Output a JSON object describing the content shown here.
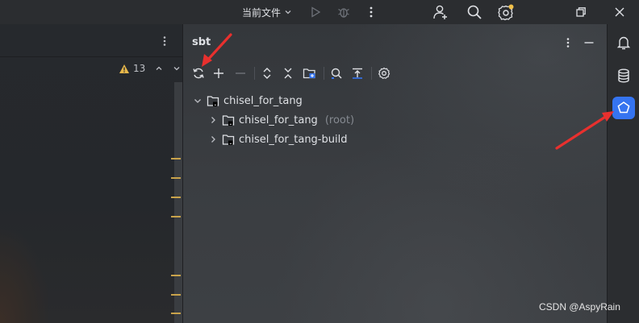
{
  "titlebar": {
    "run_config": "当前文件",
    "icons": [
      "chevron-down-icon",
      "run-icon",
      "debug-icon",
      "more-vertical-icon",
      "add-user-icon",
      "search-icon",
      "settings-icon",
      "restore-window-icon",
      "close-icon"
    ],
    "accent": "#f0c04a"
  },
  "editor": {
    "inspection_count": "13",
    "warning_color": "#e8b84a"
  },
  "sbt_panel": {
    "title": "sbt",
    "toolbar": [
      "reload-icon",
      "add-icon",
      "remove-icon",
      "expand-all-icon",
      "collapse-all-icon",
      "open-config-icon",
      "analyze-icon",
      "toggle-offline-icon",
      "settings-icon"
    ],
    "tree": {
      "root": {
        "label": "chisel_for_tang"
      },
      "children": [
        {
          "label": "chisel_for_tang",
          "hint": "(root)"
        },
        {
          "label": "chisel_for_tang-build",
          "hint": ""
        }
      ]
    }
  },
  "right_strip": {
    "items": [
      "notifications-icon",
      "database-icon",
      "sbt-icon"
    ],
    "active_color": "#3574f0"
  },
  "watermark": "CSDN @AspyRain",
  "annotation_color": "#e8302e"
}
